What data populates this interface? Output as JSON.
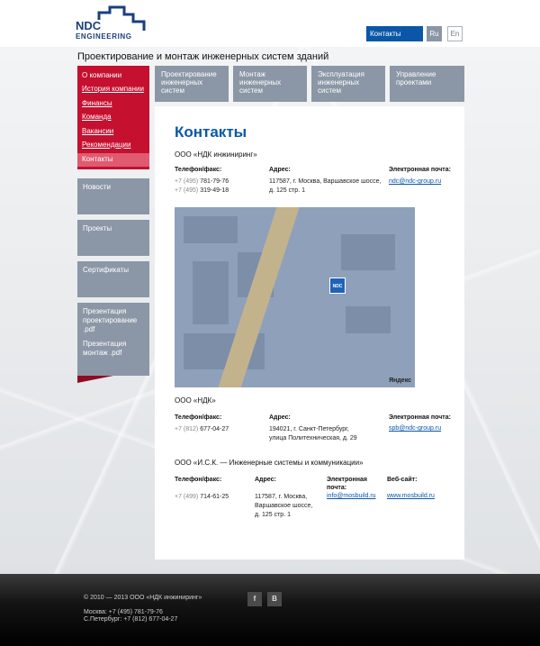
{
  "header": {
    "logo_line1": "NDC",
    "logo_line2": "ENGINEERING",
    "search_value": "Контакты",
    "lang_ru": "Ru",
    "lang_en": "En",
    "tagline": "Проектирование и монтаж инженерных систем зданий"
  },
  "sidebar": {
    "title": "О компании",
    "items": [
      "История компании",
      "Финансы",
      "Команда",
      "Вакансии",
      "Рекомендации",
      "Контакты"
    ],
    "blocks": {
      "news": "Новости",
      "projects": "Проекты",
      "certificates": "Сертификаты",
      "pres1_lines": [
        "Презентация",
        "проектирование",
        ".pdf"
      ],
      "pres2_lines": [
        "Презентация",
        "монтаж .pdf"
      ]
    }
  },
  "tabs": [
    {
      "lines": [
        "Проектирование",
        "инженерных",
        "систем"
      ]
    },
    {
      "lines": [
        "Монтаж",
        "инженерных",
        "систем"
      ]
    },
    {
      "lines": [
        "Эксплуатация",
        "инженерных",
        "систем"
      ]
    },
    {
      "lines": [
        "Управление",
        "проектами"
      ]
    }
  ],
  "content": {
    "title": "Контакты",
    "org1": {
      "name": "ООО «НДК инжиниринг»",
      "phone_label": "Телефон/факс:",
      "phone1_code": "+7 (495)",
      "phone1_num": "781-79-76",
      "phone2_code": "+7 (495)",
      "phone2_num": "319-49-18",
      "address_label": "Адрес:",
      "address_line1": "117587, г. Москва, Варшавское шоссе,",
      "address_line2": "д. 125 стр. 1",
      "email_label": "Электронная почта:",
      "email": "ndc@ndc-group.ru"
    },
    "map": {
      "pin_label": "NDC",
      "provider": "Яндекс"
    },
    "org2": {
      "name": "ООО «НДК»",
      "phone_label": "Телефон/факс:",
      "phone_code": "+7 (812)",
      "phone_num": "677-04-27",
      "address_label": "Адрес:",
      "address_line1": "194021, г. Санкт-Петербург,",
      "address_line2": "улица Политехническая, д. 29",
      "email_label": "Электронная почта:",
      "email": "spb@ndc-group.ru"
    },
    "org3": {
      "name": "ООО «И.С.К. — Инженерные системы и коммуникации»",
      "phone_label": "Телефон/факс:",
      "phone_code": "+7 (499)",
      "phone_num": "714-61-25",
      "address_label": "Адрес:",
      "address_line1": "117587, г. Москва,",
      "address_line2": "Варшавское шоссе,",
      "address_line3": "д. 125 стр. 1",
      "email_label_line1": "Электронная",
      "email_label_line2": "почта:",
      "email": "info@mosbuild.ru",
      "site_label": "Веб-сайт:",
      "site": "www.mosbuild.ru"
    }
  },
  "footer": {
    "copyright": "© 2010 — 2013 ООО «НДК инжиниринг»",
    "moscow": "Москва: +7 (495) 781-79-76",
    "spb": "С.Петербург: +7 (812) 677-04-27",
    "social1": "f",
    "social2": "В"
  },
  "colors": {
    "accent_blue": "#0a57a8",
    "menu_red": "#c5102f",
    "tab_grey": "#8b97a6"
  }
}
